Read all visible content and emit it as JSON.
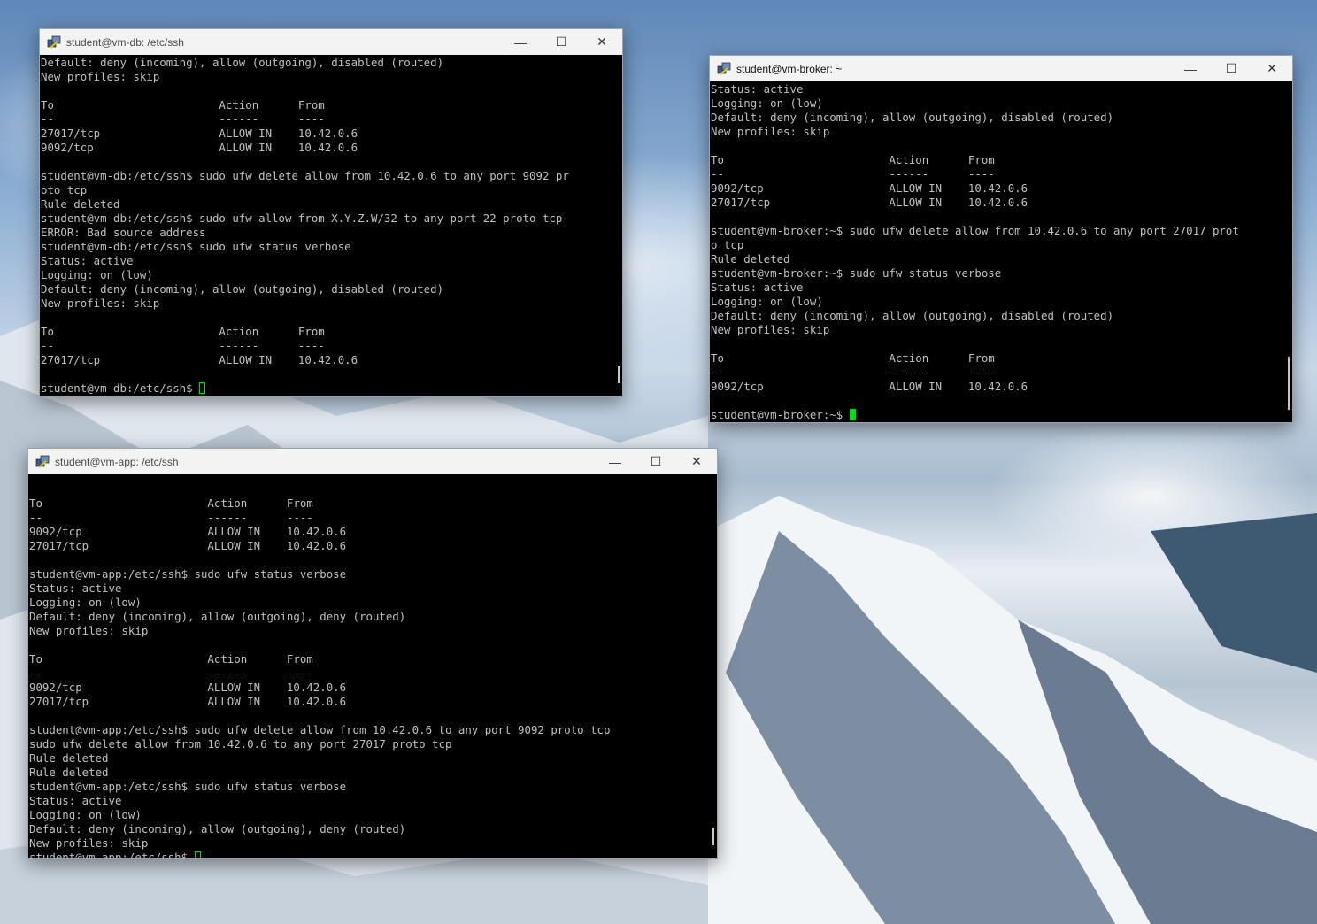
{
  "colors": {
    "cursor": "#00e000",
    "terminal_bg": "#000000",
    "terminal_fg": "#c0c0c0",
    "titlebar_bg": "#f3f3f3"
  },
  "icons": {
    "app": "putty-icon",
    "minimize": "minimize-icon",
    "maximize": "maximize-icon",
    "close": "close-icon"
  },
  "glyphs": {
    "minimize": "—",
    "maximize": "☐",
    "close": "✕"
  },
  "windows": {
    "db": {
      "title": "student@vm-db: /etc/ssh",
      "lines": [
        "Default: deny (incoming), allow (outgoing), disabled (routed)",
        "New profiles: skip",
        "",
        "To                         Action      From",
        "--                         ------      ----",
        "27017/tcp                  ALLOW IN    10.42.0.6",
        "9092/tcp                   ALLOW IN    10.42.0.6",
        "",
        "student@vm-db:/etc/ssh$ sudo ufw delete allow from 10.42.0.6 to any port 9092 pr",
        "oto tcp",
        "Rule deleted",
        "student@vm-db:/etc/ssh$ sudo ufw allow from X.Y.Z.W/32 to any port 22 proto tcp",
        "ERROR: Bad source address",
        "student@vm-db:/etc/ssh$ sudo ufw status verbose",
        "Status: active",
        "Logging: on (low)",
        "Default: deny (incoming), allow (outgoing), disabled (routed)",
        "New profiles: skip",
        "",
        "To                         Action      From",
        "--                         ------      ----",
        "27017/tcp                  ALLOW IN    10.42.0.6",
        ""
      ],
      "prompt": "student@vm-db:/etc/ssh$ "
    },
    "broker": {
      "title": "student@vm-broker: ~",
      "lines": [
        "Status: active",
        "Logging: on (low)",
        "Default: deny (incoming), allow (outgoing), disabled (routed)",
        "New profiles: skip",
        "",
        "To                         Action      From",
        "--                         ------      ----",
        "9092/tcp                   ALLOW IN    10.42.0.6",
        "27017/tcp                  ALLOW IN    10.42.0.6",
        "",
        "student@vm-broker:~$ sudo ufw delete allow from 10.42.0.6 to any port 27017 prot",
        "o tcp",
        "Rule deleted",
        "student@vm-broker:~$ sudo ufw status verbose",
        "Status: active",
        "Logging: on (low)",
        "Default: deny (incoming), allow (outgoing), disabled (routed)",
        "New profiles: skip",
        "",
        "To                         Action      From",
        "--                         ------      ----",
        "9092/tcp                   ALLOW IN    10.42.0.6",
        ""
      ],
      "prompt": "student@vm-broker:~$ "
    },
    "app": {
      "title": "student@vm-app: /etc/ssh",
      "lines": [
        "",
        "To                         Action      From",
        "--                         ------      ----",
        "9092/tcp                   ALLOW IN    10.42.0.6",
        "27017/tcp                  ALLOW IN    10.42.0.6",
        "",
        "student@vm-app:/etc/ssh$ sudo ufw status verbose",
        "Status: active",
        "Logging: on (low)",
        "Default: deny (incoming), allow (outgoing), deny (routed)",
        "New profiles: skip",
        "",
        "To                         Action      From",
        "--                         ------      ----",
        "9092/tcp                   ALLOW IN    10.42.0.6",
        "27017/tcp                  ALLOW IN    10.42.0.6",
        "",
        "student@vm-app:/etc/ssh$ sudo ufw delete allow from 10.42.0.6 to any port 9092 proto tcp",
        "sudo ufw delete allow from 10.42.0.6 to any port 27017 proto tcp",
        "Rule deleted",
        "Rule deleted",
        "student@vm-app:/etc/ssh$ sudo ufw status verbose",
        "Status: active",
        "Logging: on (low)",
        "Default: deny (incoming), allow (outgoing), deny (routed)",
        "New profiles: skip"
      ],
      "prompt": "student@vm-app:/etc/ssh$ "
    }
  }
}
